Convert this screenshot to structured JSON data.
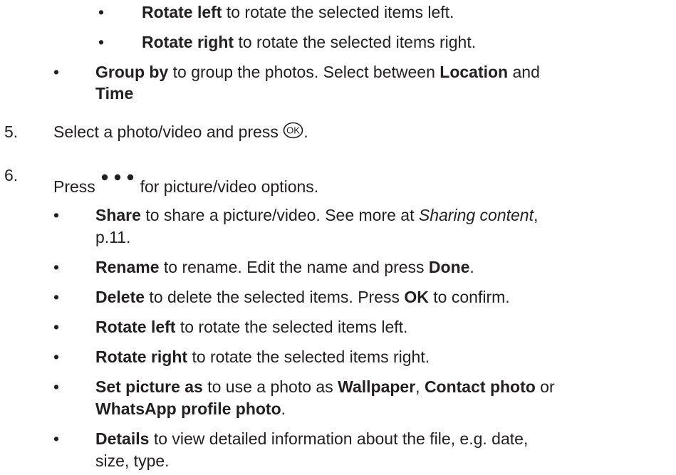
{
  "doc": {
    "sub_bullets_top": [
      {
        "term": "Rotate left",
        "desc": " to rotate the selected items left."
      },
      {
        "term": "Rotate right",
        "desc": " to rotate the selected items right."
      }
    ],
    "group_by": {
      "term": "Group by",
      "desc": " to group the photos. Select between ",
      "opt1": "Location",
      "and": " and",
      "opt2": "Time"
    },
    "step5": {
      "num": "5.",
      "text": "Select a photo/video and press ",
      "icon": "ok-button-icon",
      "after": "."
    },
    "step6": {
      "num": "6.",
      "text_before": "Press ",
      "icon": "more-options-dots-icon",
      "text_after": " for picture/video options."
    },
    "options": {
      "share": {
        "term": "Share",
        "desc": " to share a picture/video. See more at ",
        "ref": "Sharing content",
        "comma": ",",
        "page": "p.11."
      },
      "rename": {
        "term": "Rename",
        "desc": " to rename. Edit the name and press ",
        "btn": "Done",
        "end": "."
      },
      "delete": {
        "term": "Delete",
        "desc": " to delete the selected items. Press ",
        "btn": "OK",
        "end": " to confirm."
      },
      "rotate_left": {
        "term": "Rotate left",
        "desc": " to rotate the selected items left."
      },
      "rotate_right": {
        "term": "Rotate right",
        "desc": " to rotate the selected items right."
      },
      "set_picture": {
        "term": "Set picture as",
        "desc": " to use a photo as ",
        "opt1": "Wallpaper",
        "sep1": ", ",
        "opt2": "Contact photo",
        "or": " or",
        "opt3": "WhatsApp profile photo",
        "end": "."
      },
      "details": {
        "term": "Details",
        "desc": " to view detailed information about the file, e.g. date,",
        "cont": "size, type."
      }
    },
    "bullet_char": "•"
  }
}
